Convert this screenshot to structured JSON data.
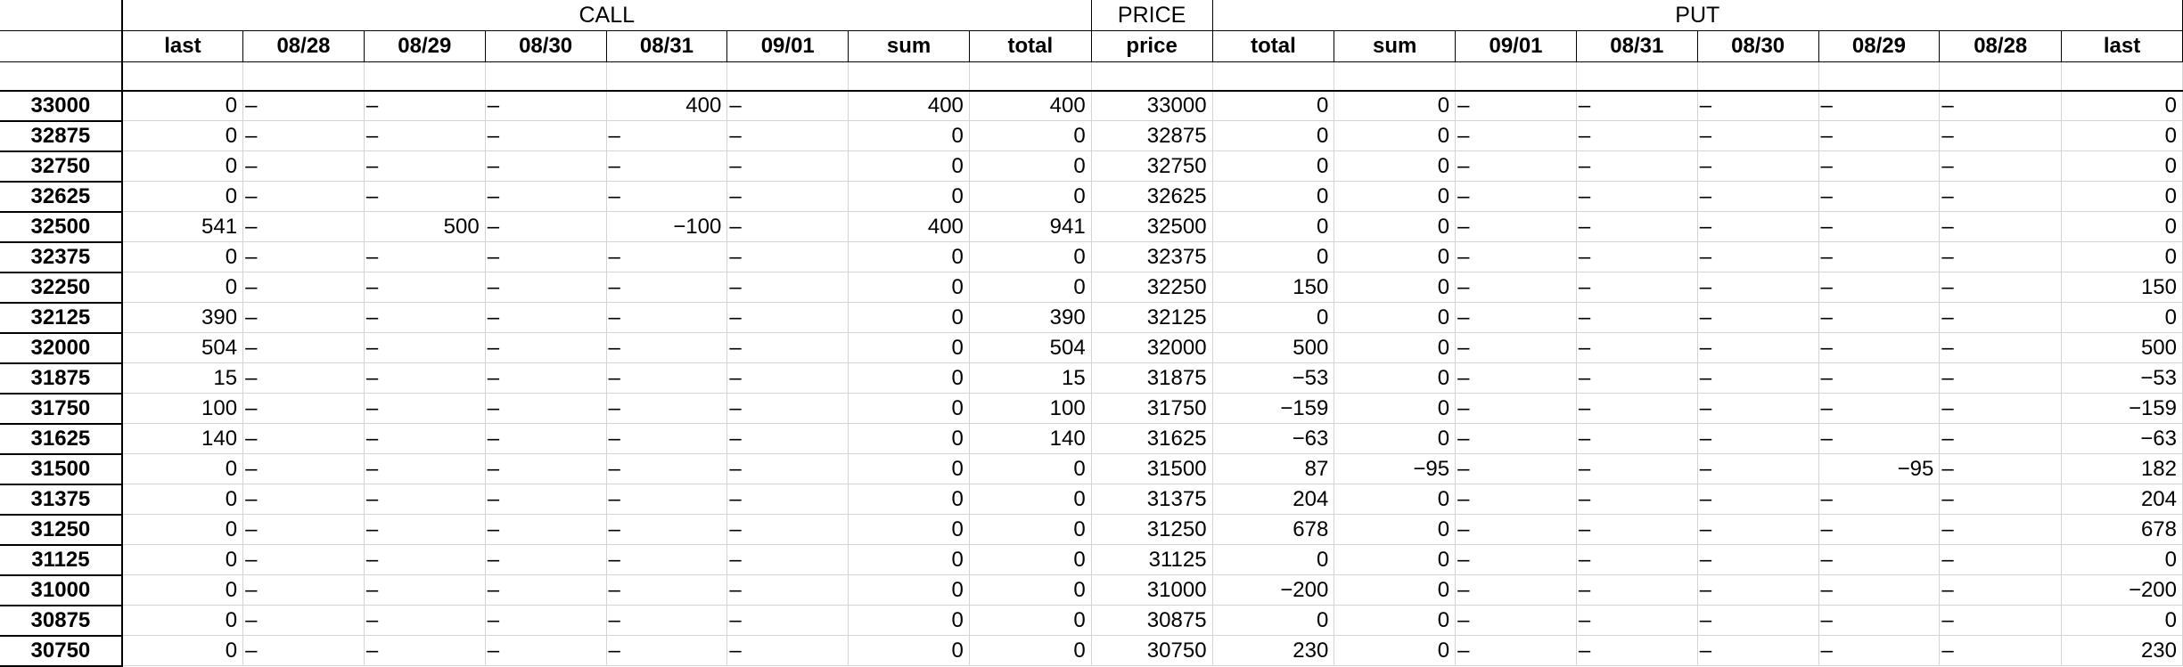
{
  "groups": {
    "call": "CALL",
    "price": "PRICE",
    "put": "PUT"
  },
  "columns": [
    "last",
    "08/28",
    "08/29",
    "08/30",
    "08/31",
    "09/01",
    "sum",
    "total",
    "price",
    "total",
    "sum",
    "09/01",
    "08/31",
    "08/30",
    "08/29",
    "08/28",
    "last"
  ],
  "rows": [
    [
      "33000",
      "0",
      "–",
      "–",
      "–",
      "400",
      "–",
      "400",
      "400",
      "33000",
      "0",
      "0",
      "–",
      "–",
      "–",
      "–",
      "–",
      "0"
    ],
    [
      "32875",
      "0",
      "–",
      "–",
      "–",
      "–",
      "–",
      "0",
      "0",
      "32875",
      "0",
      "0",
      "–",
      "–",
      "–",
      "–",
      "–",
      "0"
    ],
    [
      "32750",
      "0",
      "–",
      "–",
      "–",
      "–",
      "–",
      "0",
      "0",
      "32750",
      "0",
      "0",
      "–",
      "–",
      "–",
      "–",
      "–",
      "0"
    ],
    [
      "32625",
      "0",
      "–",
      "–",
      "–",
      "–",
      "–",
      "0",
      "0",
      "32625",
      "0",
      "0",
      "–",
      "–",
      "–",
      "–",
      "–",
      "0"
    ],
    [
      "32500",
      "541",
      "–",
      "500",
      "–",
      "−100",
      "–",
      "400",
      "941",
      "32500",
      "0",
      "0",
      "–",
      "–",
      "–",
      "–",
      "–",
      "0"
    ],
    [
      "32375",
      "0",
      "–",
      "–",
      "–",
      "–",
      "–",
      "0",
      "0",
      "32375",
      "0",
      "0",
      "–",
      "–",
      "–",
      "–",
      "–",
      "0"
    ],
    [
      "32250",
      "0",
      "–",
      "–",
      "–",
      "–",
      "–",
      "0",
      "0",
      "32250",
      "150",
      "0",
      "–",
      "–",
      "–",
      "–",
      "–",
      "150"
    ],
    [
      "32125",
      "390",
      "–",
      "–",
      "–",
      "–",
      "–",
      "0",
      "390",
      "32125",
      "0",
      "0",
      "–",
      "–",
      "–",
      "–",
      "–",
      "0"
    ],
    [
      "32000",
      "504",
      "–",
      "–",
      "–",
      "–",
      "–",
      "0",
      "504",
      "32000",
      "500",
      "0",
      "–",
      "–",
      "–",
      "–",
      "–",
      "500"
    ],
    [
      "31875",
      "15",
      "–",
      "–",
      "–",
      "–",
      "–",
      "0",
      "15",
      "31875",
      "−53",
      "0",
      "–",
      "–",
      "–",
      "–",
      "–",
      "−53"
    ],
    [
      "31750",
      "100",
      "–",
      "–",
      "–",
      "–",
      "–",
      "0",
      "100",
      "31750",
      "−159",
      "0",
      "–",
      "–",
      "–",
      "–",
      "–",
      "−159"
    ],
    [
      "31625",
      "140",
      "–",
      "–",
      "–",
      "–",
      "–",
      "0",
      "140",
      "31625",
      "−63",
      "0",
      "–",
      "–",
      "–",
      "–",
      "–",
      "−63"
    ],
    [
      "31500",
      "0",
      "–",
      "–",
      "–",
      "–",
      "–",
      "0",
      "0",
      "31500",
      "87",
      "−95",
      "–",
      "–",
      "–",
      "−95",
      "–",
      "182"
    ],
    [
      "31375",
      "0",
      "–",
      "–",
      "–",
      "–",
      "–",
      "0",
      "0",
      "31375",
      "204",
      "0",
      "–",
      "–",
      "–",
      "–",
      "–",
      "204"
    ],
    [
      "31250",
      "0",
      "–",
      "–",
      "–",
      "–",
      "–",
      "0",
      "0",
      "31250",
      "678",
      "0",
      "–",
      "–",
      "–",
      "–",
      "–",
      "678"
    ],
    [
      "31125",
      "0",
      "–",
      "–",
      "–",
      "–",
      "–",
      "0",
      "0",
      "31125",
      "0",
      "0",
      "–",
      "–",
      "–",
      "–",
      "–",
      "0"
    ],
    [
      "31000",
      "0",
      "–",
      "–",
      "–",
      "–",
      "–",
      "0",
      "0",
      "31000",
      "−200",
      "0",
      "–",
      "–",
      "–",
      "–",
      "–",
      "−200"
    ],
    [
      "30875",
      "0",
      "–",
      "–",
      "–",
      "–",
      "–",
      "0",
      "0",
      "30875",
      "0",
      "0",
      "–",
      "–",
      "–",
      "–",
      "–",
      "0"
    ],
    [
      "30750",
      "0",
      "–",
      "–",
      "–",
      "–",
      "–",
      "0",
      "0",
      "30750",
      "230",
      "0",
      "–",
      "–",
      "–",
      "–",
      "–",
      "230"
    ]
  ]
}
